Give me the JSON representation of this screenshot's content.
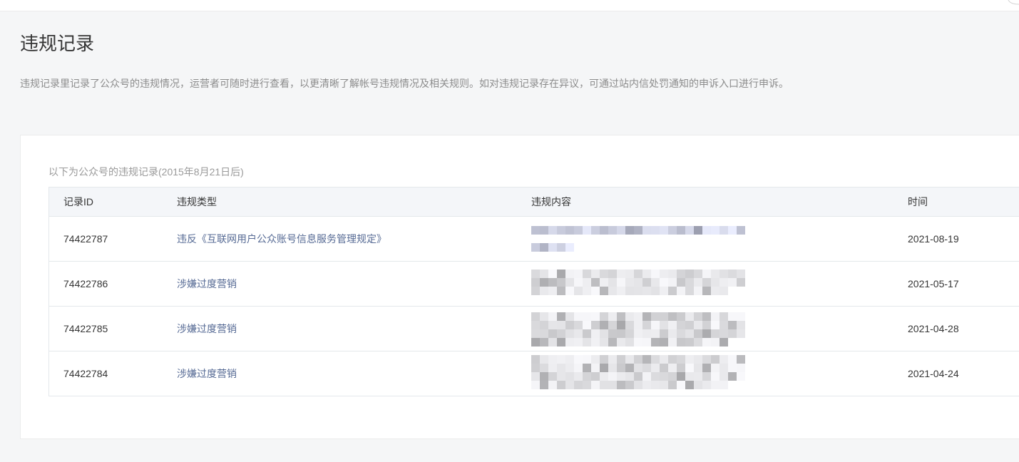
{
  "page": {
    "title": "违规记录",
    "description": "违规记录里记录了公众号的违规情况，运营者可随时进行查看，以更清晰了解帐号违规情况及相关规则。如对违规记录存在异议，可通过站内信处罚通知的申诉入口进行申诉。"
  },
  "records": {
    "subtitle": "以下为公众号的违规记录(2015年8月21日后)",
    "columns": {
      "id": "记录ID",
      "type": "违规类型",
      "content": "违规内容",
      "time": "时间"
    },
    "rows": [
      {
        "id": "74422787",
        "type": "违反《互联网用户公众账号信息服务管理规定》",
        "time": "2021-08-19"
      },
      {
        "id": "74422786",
        "type": "涉嫌过度营销",
        "time": "2021-05-17"
      },
      {
        "id": "74422785",
        "type": "涉嫌过度营销",
        "time": "2021-04-28"
      },
      {
        "id": "74422784",
        "type": "涉嫌过度营销",
        "time": "2021-04-24"
      }
    ]
  },
  "colors": {
    "link": "#576b95",
    "text": "#353535",
    "background": "#f5f6f7",
    "table_header_background": "#f4f6f9"
  }
}
